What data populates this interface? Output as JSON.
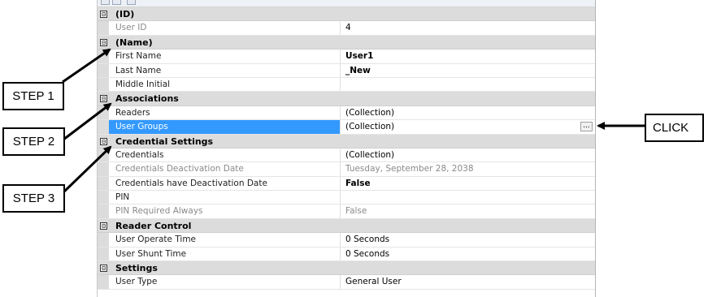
{
  "grid": {
    "collapse_glyph": "⊟",
    "categories": [
      {
        "label": "(ID)",
        "rows": [
          {
            "name": "User ID",
            "value": "4",
            "name_dim": true,
            "value_dim": false,
            "bold": false
          }
        ]
      },
      {
        "label": "(Name)",
        "rows": [
          {
            "name": "First Name",
            "value": "User1",
            "bold": true
          },
          {
            "name": "Last Name",
            "value": "_New",
            "bold": true
          },
          {
            "name": "Middle Initial",
            "value": ""
          }
        ]
      },
      {
        "label": "Associations",
        "rows": [
          {
            "name": "Readers",
            "value": "(Collection)"
          },
          {
            "name": "User Groups",
            "value": "(Collection)",
            "selected": true,
            "has_ellipsis": true
          }
        ]
      },
      {
        "label": "Credential Settings",
        "rows": [
          {
            "name": "Credentials",
            "value": "(Collection)"
          },
          {
            "name": "Credentials Deactivation Date",
            "value": "Tuesday, September 28, 2038",
            "name_dim": true,
            "value_dim": true
          },
          {
            "name": "Credentials have Deactivation Date",
            "value": "False",
            "bold": true
          },
          {
            "name": "PIN",
            "value": ""
          },
          {
            "name": "PIN Required Always",
            "value": "False",
            "name_dim": true,
            "value_dim": true
          }
        ]
      },
      {
        "label": "Reader Control",
        "rows": [
          {
            "name": "User Operate Time",
            "value": "0 Seconds"
          },
          {
            "name": "User Shunt Time",
            "value": "0 Seconds"
          }
        ]
      },
      {
        "label": "Settings",
        "rows": [
          {
            "name": "User Type",
            "value": "General User"
          }
        ]
      }
    ],
    "ellipsis_label": "..."
  },
  "callouts": {
    "step1": "STEP 1",
    "step2": "STEP 2",
    "step3": "STEP 3",
    "click": "CLICK"
  }
}
